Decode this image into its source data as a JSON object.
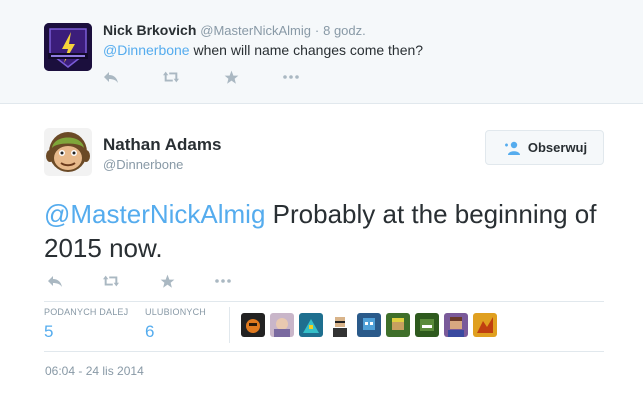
{
  "reply": {
    "name": "Nick Brkovich",
    "handle": "@MasterNickAlmig",
    "time": "8 godz.",
    "mention": "@Dinnerbone",
    "text": " when will name changes come then?"
  },
  "tweet": {
    "name": "Nathan Adams",
    "handle": "@Dinnerbone",
    "follow_label": "Obserwuj",
    "mention": "@MasterNickAlmig",
    "text": " Probably at the beginning of 2015 now.",
    "timestamp": "06:04 - 24 lis 2014"
  },
  "stats": {
    "retweets_label": "PODANYCH DALEJ",
    "retweets_value": "5",
    "favorites_label": "ULUBIONYCH",
    "favorites_value": "6"
  },
  "icons": {
    "reply": "reply-icon",
    "retweet": "retweet-icon",
    "favorite": "star-icon",
    "more": "more-icon",
    "follow": "follow-person-icon"
  },
  "colors": {
    "link": "#55acee",
    "muted": "#8899a6",
    "icon": "#aab8c2",
    "reply_bg": "#f5f8fa"
  }
}
